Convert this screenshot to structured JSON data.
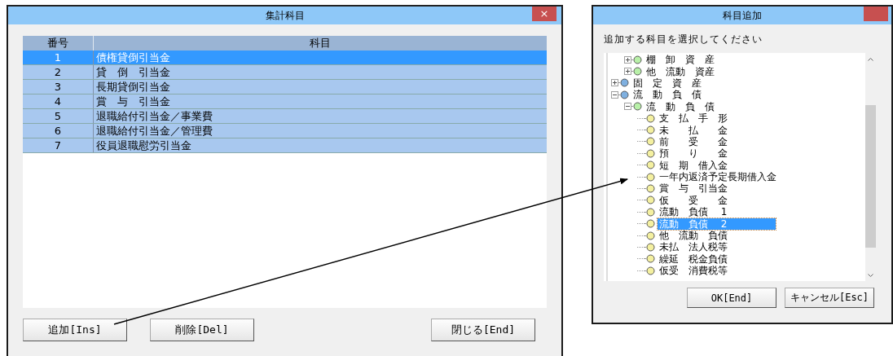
{
  "main_window": {
    "title": "集計科目",
    "close_label": "×",
    "table": {
      "columns": [
        "番号",
        "科目"
      ],
      "rows": [
        {
          "number": "1",
          "subject": "債権貸倒引当金",
          "selected": true
        },
        {
          "number": "2",
          "subject": "貸　倒　引当金",
          "selected": false
        },
        {
          "number": "3",
          "subject": "長期貸倒引当金",
          "selected": false
        },
        {
          "number": "4",
          "subject": "賞　与　引当金",
          "selected": false
        },
        {
          "number": "5",
          "subject": "退職給付引当金／事業費",
          "selected": false
        },
        {
          "number": "6",
          "subject": "退職給付引当金／管理費",
          "selected": false
        },
        {
          "number": "7",
          "subject": "役員退職慰労引当金",
          "selected": false
        }
      ]
    },
    "buttons": [
      "追加[Ins]",
      "削除[Del]",
      "閉じる[End]"
    ]
  },
  "dialog": {
    "title": "科目追加",
    "prompt": "追加する科目を選択してください",
    "tree": {
      "partial_branch": [
        {
          "label": "棚　卸　資　産",
          "expanded": false,
          "color": "#b8f0a8",
          "selected": false
        },
        {
          "label": "他　流動　資産",
          "expanded": false,
          "color": "#b8f0a8",
          "selected": false
        }
      ],
      "items": [
        {
          "label": "固　定　資　産",
          "expanded": false,
          "color": "#7fb0e0",
          "selected": false
        },
        {
          "label": "流　動　負　債",
          "expanded": true,
          "color": "#7fb0e0",
          "selected": false,
          "children": [
            {
              "label": "流　動　負　債",
              "expanded": true,
              "color": "#b8f0a8",
              "selected": false,
              "children": [
                {
                  "label": "支　払　手　形",
                  "color": "#f4f0a0",
                  "selected": false
                },
                {
                  "label": "未　　払　　金",
                  "color": "#f4f0a0",
                  "selected": false
                },
                {
                  "label": "前　　受　　金",
                  "color": "#f4f0a0",
                  "selected": false
                },
                {
                  "label": "預　　り　　金",
                  "color": "#f4f0a0",
                  "selected": false
                },
                {
                  "label": "短　期　借入金",
                  "color": "#f4f0a0",
                  "selected": false
                },
                {
                  "label": "一年内返済予定長期借入金",
                  "color": "#f4f0a0",
                  "selected": false
                },
                {
                  "label": "賞　与　引当金",
                  "color": "#f4f0a0",
                  "selected": false
                },
                {
                  "label": "仮　　受　　金",
                  "color": "#f4f0a0",
                  "selected": false
                },
                {
                  "label": "流動　負債　 1",
                  "color": "#f4f0a0",
                  "selected": false
                },
                {
                  "label": "流動　負債　 2",
                  "color": "#f4f0a0",
                  "selected": true
                },
                {
                  "label": "他　流動　負債",
                  "color": "#f4f0a0",
                  "selected": false
                },
                {
                  "label": "未払　法人税等",
                  "color": "#f4f0a0",
                  "selected": false
                },
                {
                  "label": "繰延　税金負債",
                  "color": "#f4f0a0",
                  "selected": false
                },
                {
                  "label": "仮受　消費税等",
                  "color": "#f4f0a0",
                  "selected": false
                }
              ]
            }
          ]
        }
      ]
    },
    "buttons": [
      "OK[End]",
      "キャンセル[Esc]"
    ]
  }
}
